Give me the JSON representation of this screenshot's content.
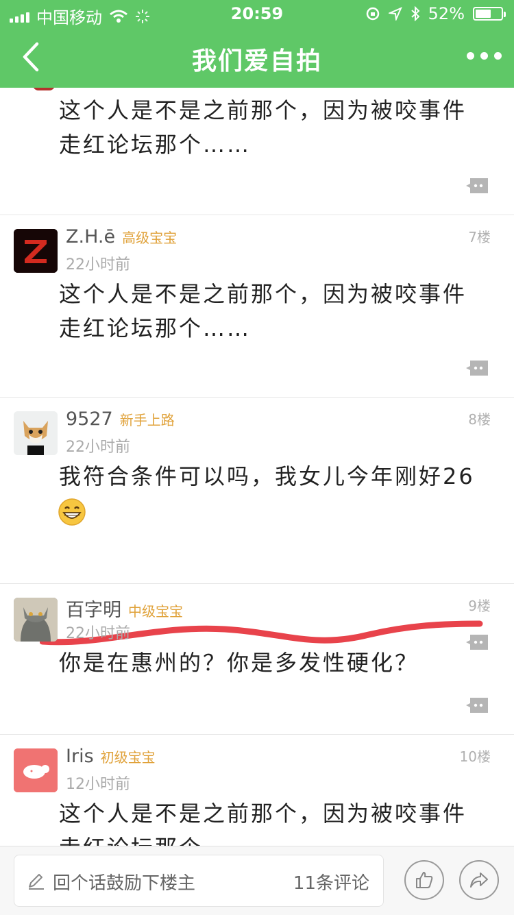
{
  "status_bar": {
    "carrier": "中国移动",
    "time": "20:59",
    "battery": "52%"
  },
  "nav": {
    "title": "我们爱自拍"
  },
  "posts": [
    {
      "content": "这个人是不是之前那个，因为被咬事件走红论坛那个……"
    },
    {
      "username": "Z.H.ē",
      "rank": "高级宝宝",
      "time": "22小时前",
      "floor": "7楼",
      "content": "这个人是不是之前那个，因为被咬事件走红论坛那个……"
    },
    {
      "username": "9527",
      "rank": "新手上路",
      "time": "22小时前",
      "floor": "8楼",
      "content": "我符合条件可以吗，我女儿今年刚好26"
    },
    {
      "username": "百字明",
      "rank": "中级宝宝",
      "time": "22小时前",
      "floor": "9楼",
      "content": "你是在惠州的？你是多发性硬化？"
    },
    {
      "username": "Iris",
      "rank": "初级宝宝",
      "time": "12小时前",
      "floor": "10楼",
      "content": "这个人是不是之前那个，因为被咬事件走红论坛那个……"
    }
  ],
  "bottom_bar": {
    "placeholder": "回个话鼓励下楼主",
    "comment_count": "11条评论"
  },
  "icons": [
    "signal-icon",
    "wifi-icon",
    "loading-icon",
    "lock-rotation-icon",
    "location-icon",
    "bluetooth-icon",
    "battery-icon",
    "back-icon",
    "more-icon",
    "reply-icon",
    "pen-icon",
    "thumbs-up-icon",
    "share-icon",
    "grin-emoji-icon"
  ],
  "colors": {
    "brand_green": "#5fc867",
    "rank_gold": "#e0a23a",
    "annotation_red": "#e8434b"
  }
}
